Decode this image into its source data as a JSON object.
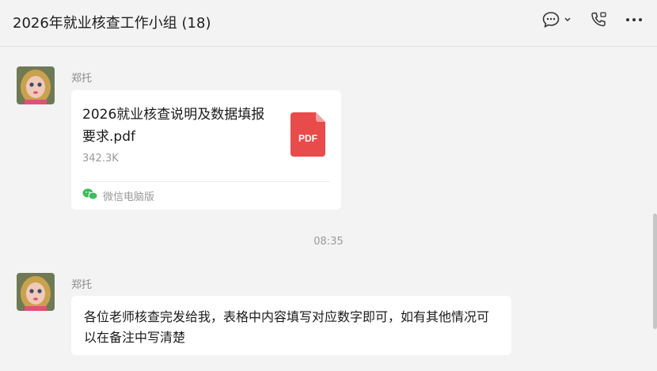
{
  "header": {
    "title": "2026年就业核查工作小组 (18)",
    "icons": [
      "chat-bubble-icon",
      "chevron-down-icon",
      "phone-icon",
      "more-icon"
    ]
  },
  "messages": [
    {
      "sender": "郑托",
      "type": "file",
      "file": {
        "name": "2026就业核查说明及数据填报要求.pdf",
        "size": "342.3K",
        "type_label": "PDF",
        "source": "微信电脑版"
      }
    },
    {
      "type": "timestamp",
      "text": "08:35"
    },
    {
      "sender": "郑托",
      "type": "text",
      "text": "各位老师核查完发给我，表格中内容填写对应数字即可，如有其他情况可以在备注中写清楚"
    }
  ],
  "colors": {
    "background": "#f3f3f3",
    "bubble": "#ffffff",
    "pdf_red": "#e94b4b",
    "wechat_green": "#3bbd5a",
    "muted_text": "#9a9a9a"
  }
}
